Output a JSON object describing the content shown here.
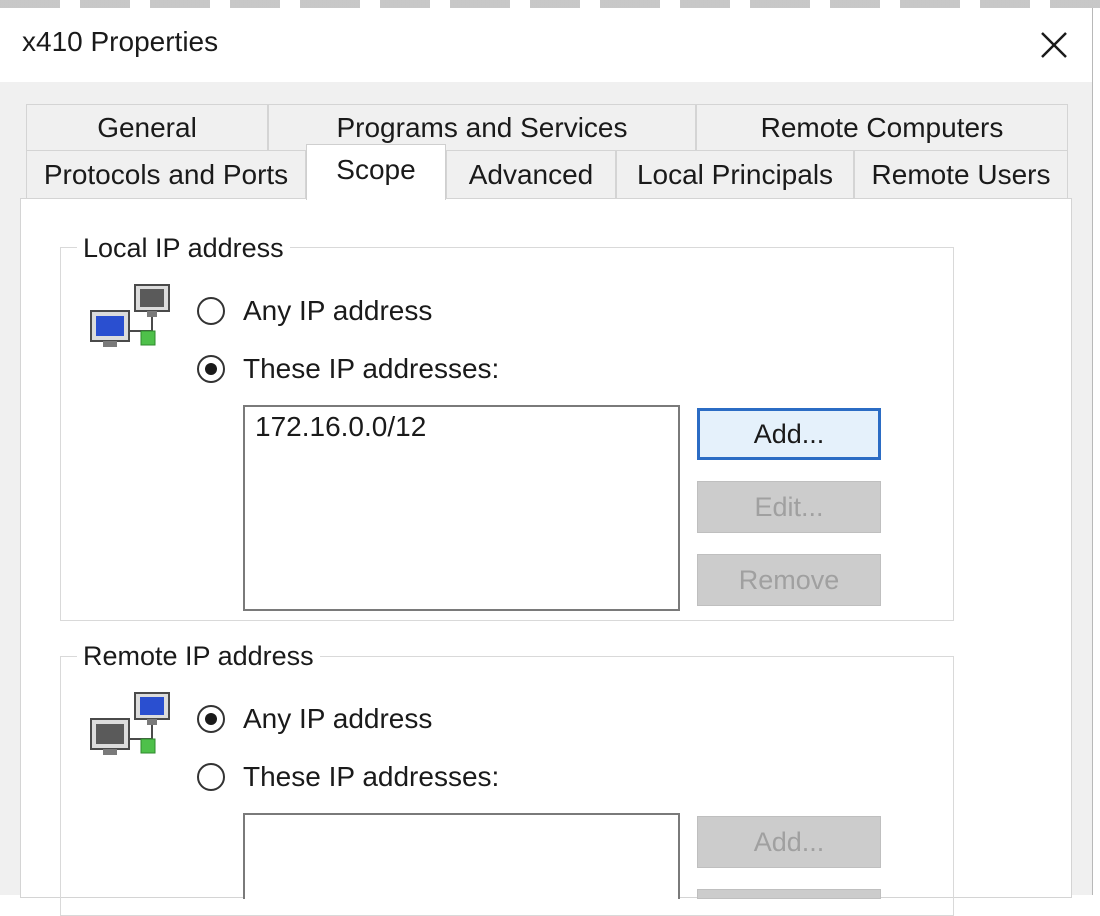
{
  "window": {
    "title": "x410 Properties"
  },
  "tabs": {
    "row1": [
      "General",
      "Programs and Services",
      "Remote Computers"
    ],
    "row2": [
      "Protocols and Ports",
      "Scope",
      "Advanced",
      "Local Principals",
      "Remote Users"
    ],
    "active": "Scope"
  },
  "local": {
    "label": "Local IP address",
    "any_label": "Any IP address",
    "these_label": "These IP addresses:",
    "selected": "these",
    "addresses": [
      "172.16.0.0/12"
    ],
    "buttons": {
      "add": "Add...",
      "edit": "Edit...",
      "remove": "Remove"
    }
  },
  "remote": {
    "label": "Remote IP address",
    "any_label": "Any IP address",
    "these_label": "These IP addresses:",
    "selected": "any",
    "addresses": [],
    "buttons": {
      "add": "Add..."
    }
  },
  "icons": {
    "close": "close-icon",
    "local_network": "network-computers-icon",
    "remote_network": "network-computers-icon"
  },
  "colors": {
    "accent": "#2b6cc4",
    "disabled_text": "#a0a0a0"
  }
}
